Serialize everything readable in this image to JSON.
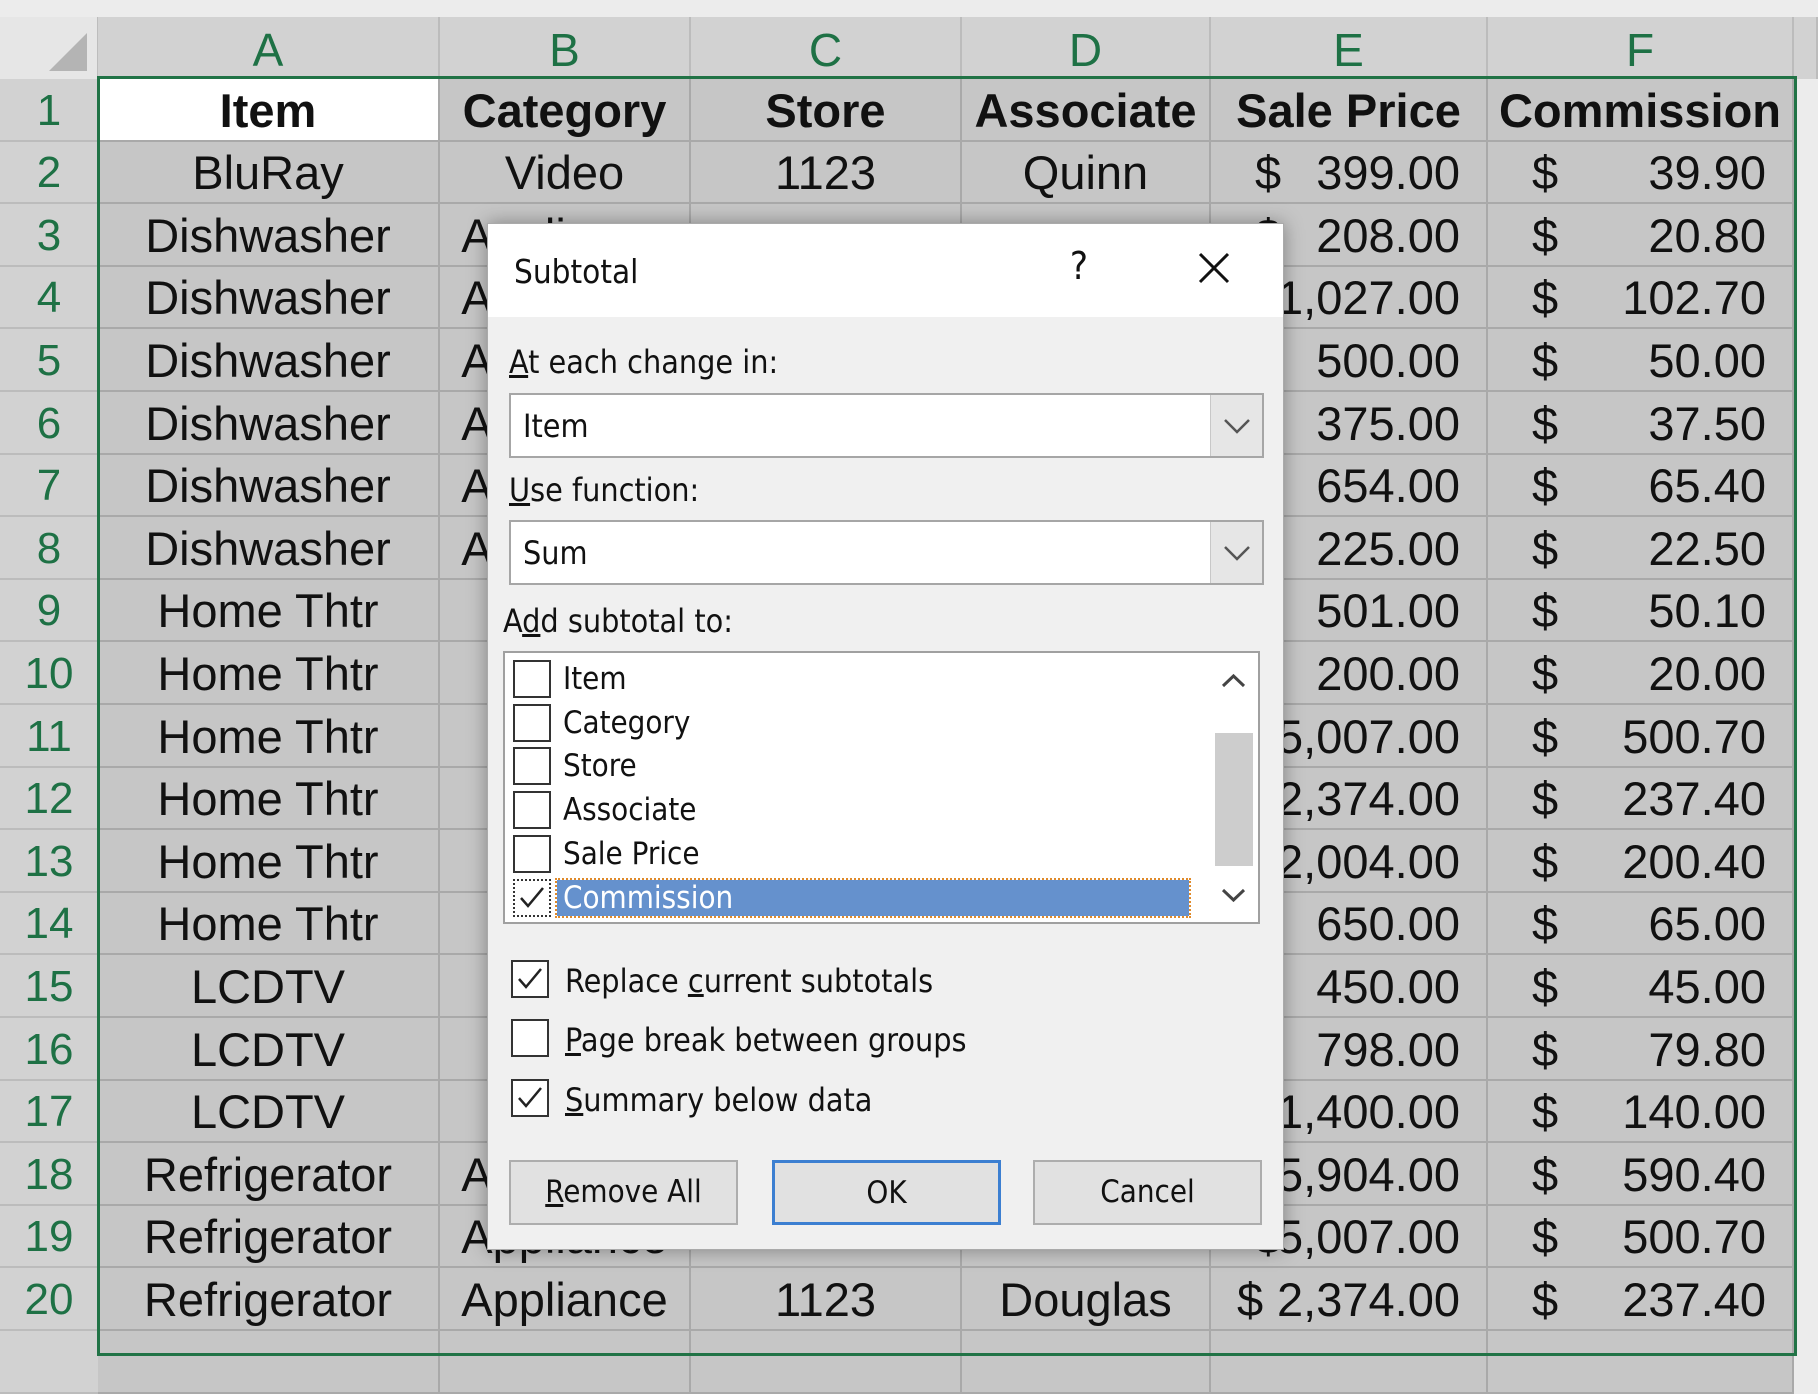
{
  "spreadsheet": {
    "columns": [
      "A",
      "B",
      "C",
      "D",
      "E",
      "F"
    ],
    "row_numbers": [
      "1",
      "2",
      "3",
      "4",
      "5",
      "6",
      "7",
      "8",
      "9",
      "10",
      "11",
      "12",
      "13",
      "14",
      "15",
      "16",
      "17",
      "18",
      "19",
      "20"
    ],
    "header": [
      "Item",
      "Category",
      "Store",
      "Associate",
      "Sale Price",
      "Commission"
    ],
    "currency_symbol": "$",
    "rows": [
      {
        "item": "BluRay",
        "category": "Video",
        "store": "1123",
        "associate": "Quinn",
        "sale_price": "399.00",
        "commission": "39.90"
      },
      {
        "item": "Dishwasher",
        "category": "Appliance",
        "store": "",
        "associate": "",
        "sale_price": "208.00",
        "commission": "20.80"
      },
      {
        "item": "Dishwasher",
        "category": "Appliance",
        "store": "",
        "associate": "",
        "sale_price": "1,027.00",
        "commission": "102.70"
      },
      {
        "item": "Dishwasher",
        "category": "Appliance",
        "store": "",
        "associate": "",
        "sale_price": "500.00",
        "commission": "50.00"
      },
      {
        "item": "Dishwasher",
        "category": "Appliance",
        "store": "",
        "associate": "",
        "sale_price": "375.00",
        "commission": "37.50"
      },
      {
        "item": "Dishwasher",
        "category": "Appliance",
        "store": "",
        "associate": "",
        "sale_price": "654.00",
        "commission": "65.40"
      },
      {
        "item": "Dishwasher",
        "category": "Appliance",
        "store": "",
        "associate": "",
        "sale_price": "225.00",
        "commission": "22.50"
      },
      {
        "item": "Home Thtr",
        "category": "",
        "store": "",
        "associate": "",
        "sale_price": "501.00",
        "commission": "50.10"
      },
      {
        "item": "Home Thtr",
        "category": "",
        "store": "",
        "associate": "",
        "sale_price": "200.00",
        "commission": "20.00"
      },
      {
        "item": "Home Thtr",
        "category": "",
        "store": "",
        "associate": "",
        "sale_price": "5,007.00",
        "commission": "500.70"
      },
      {
        "item": "Home Thtr",
        "category": "",
        "store": "",
        "associate": "",
        "sale_price": "2,374.00",
        "commission": "237.40"
      },
      {
        "item": "Home Thtr",
        "category": "",
        "store": "",
        "associate": "",
        "sale_price": "2,004.00",
        "commission": "200.40"
      },
      {
        "item": "Home Thtr",
        "category": "",
        "store": "",
        "associate": "",
        "sale_price": "650.00",
        "commission": "65.00"
      },
      {
        "item": "LCDTV",
        "category": "",
        "store": "",
        "associate": "",
        "sale_price": "450.00",
        "commission": "45.00"
      },
      {
        "item": "LCDTV",
        "category": "",
        "store": "",
        "associate": "",
        "sale_price": "798.00",
        "commission": "79.80"
      },
      {
        "item": "LCDTV",
        "category": "",
        "store": "",
        "associate": "",
        "sale_price": "1,400.00",
        "commission": "140.00"
      },
      {
        "item": "Refrigerator",
        "category": "Appliance",
        "store": "",
        "associate": "",
        "sale_price": "5,904.00",
        "commission": "590.40"
      },
      {
        "item": "Refrigerator",
        "category": "Appliance",
        "store": "",
        "associate": "",
        "sale_price": "5,007.00",
        "commission": "500.70"
      },
      {
        "item": "Refrigerator",
        "category": "Appliance",
        "store": "1123",
        "associate": "Douglas",
        "sale_price": "2,374.00",
        "commission": "237.40"
      }
    ],
    "colors": {
      "selection_border": "#217346",
      "header_text": "#1e7145",
      "selected_cell": "#c6c6c6"
    }
  },
  "dialog": {
    "title": "Subtotal",
    "help_label": "?",
    "close_icon": "close-icon",
    "at_each_change_label": {
      "mnemonic": "A",
      "rest": "t each change in:"
    },
    "at_each_change_value": "Item",
    "use_function_label": {
      "mnemonic": "U",
      "rest": "se function:"
    },
    "use_function_value": "Sum",
    "add_subtotal_label": {
      "pre": "A",
      "mnemonic": "d",
      "rest": "d subtotal to:"
    },
    "subtotal_fields": [
      {
        "label": "Item",
        "checked": false
      },
      {
        "label": "Category",
        "checked": false
      },
      {
        "label": "Store",
        "checked": false
      },
      {
        "label": "Associate",
        "checked": false
      },
      {
        "label": " Sale Price",
        "checked": false
      },
      {
        "label": "Commission",
        "checked": true,
        "selected": true
      }
    ],
    "options": [
      {
        "pre": "Replace ",
        "mnemonic": "c",
        "rest": "urrent subtotals",
        "checked": true
      },
      {
        "pre": "",
        "mnemonic": "P",
        "rest": "age break between groups",
        "checked": false
      },
      {
        "pre": "",
        "mnemonic": "S",
        "rest": "ummary below data",
        "checked": true
      }
    ],
    "buttons": {
      "remove_all": {
        "mnemonic": "R",
        "rest": "emove All"
      },
      "ok": "OK",
      "cancel": "Cancel"
    },
    "colors": {
      "selected_item": "#6591cd",
      "default_button_border": "#3c7fd1"
    }
  }
}
